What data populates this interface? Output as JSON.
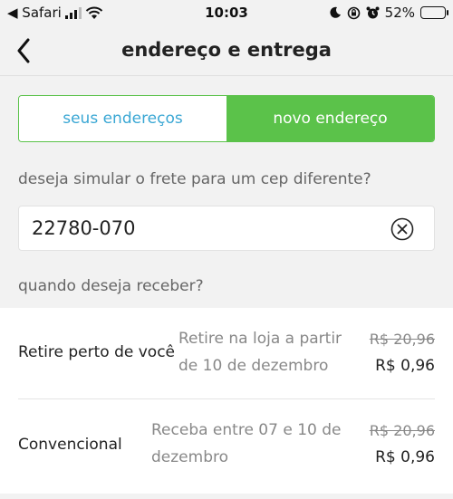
{
  "status_bar": {
    "carrier": "◀ Safari",
    "time": "10:03",
    "battery_percent": "52%",
    "battery_level": 0.52
  },
  "nav": {
    "title": "endereço e entrega"
  },
  "tabs": {
    "inactive_label": "seus endereços",
    "active_label": "novo endereço"
  },
  "cep": {
    "prompt": "deseja simular o frete para um cep diferente?",
    "value": "22780-070"
  },
  "delivery": {
    "prompt": "quando deseja receber?",
    "options": [
      {
        "name": "Retire perto de você",
        "desc_line1": "Retire na loja a partir",
        "desc_line2": "de 10 de dezembro",
        "old_price": "R$ 20,96",
        "price": "R$ 0,96"
      },
      {
        "name": "Convencional",
        "desc_line1": "Receba entre 07 e 10 de",
        "desc_line2": "dezembro",
        "old_price": "R$ 20,96",
        "price": "R$ 0,96"
      }
    ]
  },
  "colors": {
    "accent_green": "#5bc24a",
    "link_blue": "#3aa7d4"
  }
}
